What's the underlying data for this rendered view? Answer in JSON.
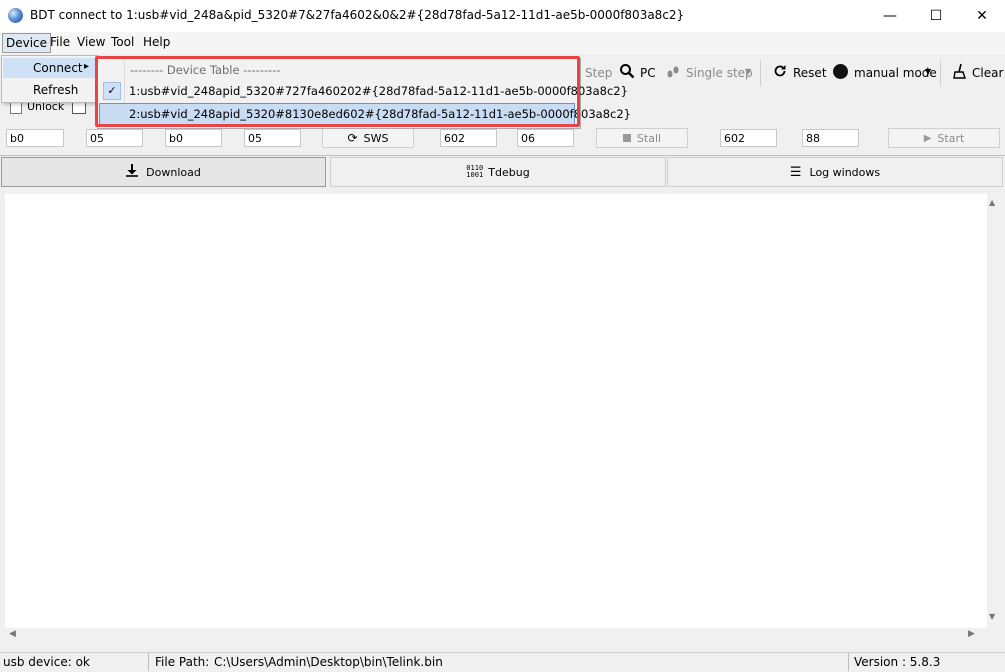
{
  "window": {
    "title": "BDT connect to 1:usb#vid_248a&pid_5320#7&27fa4602&0&2#{28d78fad-5a12-11d1-ae5b-0000f803a8c2}",
    "minimize_glyph": "—",
    "maximize_glyph": "☐",
    "close_glyph": "✕"
  },
  "menubar": {
    "device": "Device",
    "file": "File",
    "view": "View",
    "tool": "Tool",
    "help": "Help"
  },
  "device_menu": {
    "connect": "Connect",
    "refresh": "Refresh",
    "arrow": "▸"
  },
  "connect_submenu": {
    "header": "-------- Device Table ---------",
    "items": [
      {
        "label": "1:usb#vid_248apid_5320#727fa460202#{28d78fad-5a12-11d1-ae5b-0000f803a8c2}",
        "checked": true
      },
      {
        "label": "2:usb#vid_248apid_5320#8130e8ed602#{28d78fad-5a12-11d1-ae5b-0000f803a8c2}",
        "checked": false
      }
    ],
    "check_glyph": "✓"
  },
  "toolbar": {
    "step": "Step",
    "pc": "PC",
    "single_step": "Single step",
    "reset": "Reset",
    "manual_mode": "manual mode",
    "clear": "Clear"
  },
  "row2": {
    "unlock": "Unlock"
  },
  "fields": {
    "f1": "b0",
    "f2": "05",
    "f3": "b0",
    "f4": "05",
    "sws_button": "SWS",
    "f5": "602",
    "f6": "06",
    "stall_button": "Stall",
    "f7": "602",
    "f8": "88",
    "start_button": "Start"
  },
  "tabs": {
    "download": "Download",
    "tdebug": "Tdebug",
    "log_windows": "Log windows"
  },
  "status": {
    "device": "usb device: ok",
    "file_path_label": "File Path:",
    "file_path": "C:\\Users\\Admin\\Desktop\\bin\\Telink.bin",
    "version": "Version : 5.8.3"
  }
}
